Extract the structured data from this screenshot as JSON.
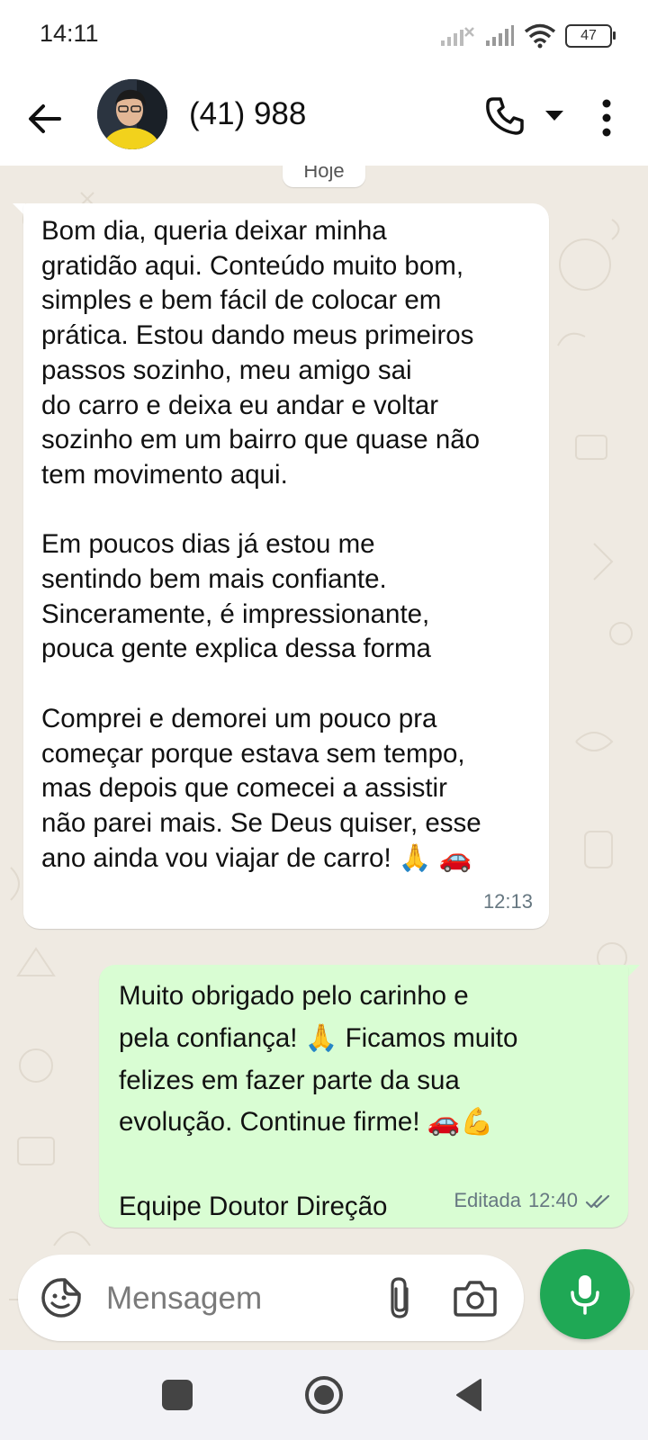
{
  "status_bar": {
    "time": "14:11",
    "battery": "47"
  },
  "header": {
    "contact_name": "(41) 988"
  },
  "chat": {
    "date_chip": "Hoje",
    "incoming": {
      "text": "Bom dia, queria deixar minha\ngratidão aqui. Conteúdo muito bom,\nsimples e bem fácil de colocar em\nprática. Estou dando meus primeiros\npassos sozinho, meu amigo sai\ndo carro e deixa eu andar e voltar\nsozinho em um bairro que quase não\ntem movimento aqui.\n\nEm poucos dias já estou me\nsentindo bem mais confiante.\nSinceramente, é impressionante,\npouca gente explica dessa forma\n\nComprei e demorei um pouco pra\ncomeçar porque estava sem tempo,\nmas depois que comecei a assistir\nnão parei mais. Se Deus quiser, esse\nano ainda vou viajar de carro! 🙏 🚗",
      "time": "12:13"
    },
    "outgoing": {
      "text": "Muito obrigado pelo carinho e\npela confiança! 🙏 Ficamos muito\nfelizes em fazer parte da sua\nevolução. Continue firme! 🚗💪\n\nEquipe Doutor Direção",
      "edited_label": "Editada",
      "time": "12:40",
      "status_icon": "double-check-icon"
    }
  },
  "composer": {
    "placeholder": "Mensagem"
  },
  "colors": {
    "incoming_bubble": "#ffffff",
    "outgoing_bubble": "#d9fdd3",
    "mic_button": "#1fa855",
    "chat_background": "#efeae2"
  }
}
